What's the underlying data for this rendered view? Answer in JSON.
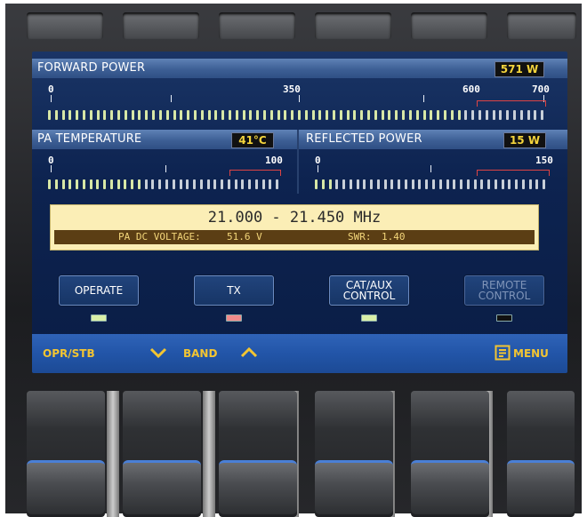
{
  "forward_power": {
    "title": "FORWARD POWER",
    "value": "571 W",
    "scale": [
      "0",
      "350",
      "600",
      "700"
    ]
  },
  "pa_temperature": {
    "title": "PA TEMPERATURE",
    "value": "41°C",
    "scale": [
      "0",
      "100"
    ]
  },
  "reflected_power": {
    "title": "REFLECTED POWER",
    "value": "15 W",
    "scale": [
      "0",
      "150"
    ]
  },
  "band": {
    "frequency": "21.000 - 21.450 MHz",
    "pa_dc_voltage_label": "PA DC VOLTAGE:",
    "pa_dc_voltage_value": "51.6 V",
    "swr_label": "SWR:",
    "swr_value": "1.40"
  },
  "controls": [
    {
      "label": "OPERATE",
      "led": "#d9f0a8"
    },
    {
      "label": "TX",
      "led": "#f08a8a"
    },
    {
      "label": "CAT/AUX\nCONTROL",
      "led": "#d9f0a8"
    },
    {
      "label": "REMOTE\nCONTROL",
      "led": "#111111"
    }
  ],
  "footer": {
    "opr_stb": "OPR/STB",
    "band": "BAND",
    "menu": "MENU"
  },
  "colors": {
    "accent": "#f3c532",
    "screen_bg": "#0d2350"
  }
}
